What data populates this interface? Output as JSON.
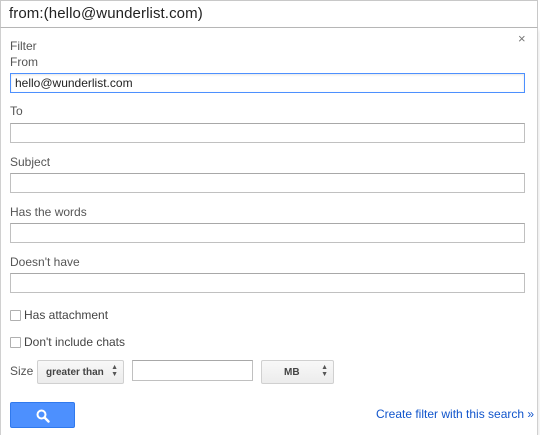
{
  "search": {
    "query": "from:(hello@wunderlist.com)"
  },
  "filter": {
    "title": "Filter",
    "close_glyph": "×",
    "from_label": "From",
    "from_value": "hello@wunderlist.com",
    "to_label": "To",
    "to_value": "",
    "subject_label": "Subject",
    "subject_value": "",
    "has_words_label": "Has the words",
    "has_words_value": "",
    "doesnt_have_label": "Doesn't have",
    "doesnt_have_value": "",
    "has_attachment_label": "Has attachment",
    "has_attachment_checked": false,
    "dont_include_chats_label": "Don't include chats",
    "dont_include_chats_checked": false,
    "size_label": "Size",
    "size_operator": "greater than",
    "size_value": "",
    "size_unit": "MB",
    "search_button_icon": "search-icon",
    "create_filter_link": "Create filter with this search »"
  },
  "colors": {
    "accent": "#4d90fe",
    "link": "#1155cc",
    "focus_border": "#4d90fe"
  }
}
